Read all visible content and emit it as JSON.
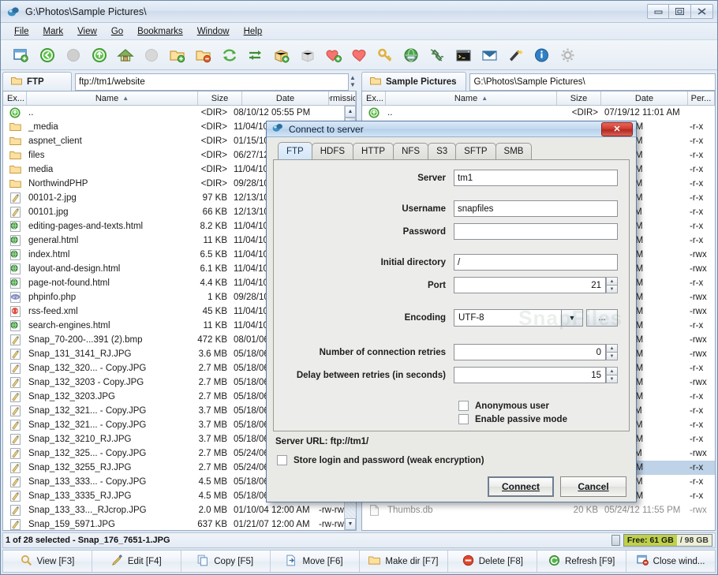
{
  "window": {
    "title": "G:\\Photos\\Sample Pictures\\",
    "icon": "app-icon",
    "minimize": "—",
    "maximize": "❐",
    "close": "✕"
  },
  "menu": [
    "File",
    "Mark",
    "View",
    "Go",
    "Bookmarks",
    "Window",
    "Help"
  ],
  "toolbar": [
    {
      "name": "new-tab-icon"
    },
    {
      "name": "back-icon"
    },
    {
      "name": "forward-icon"
    },
    {
      "name": "up-icon"
    },
    {
      "name": "home-icon"
    },
    {
      "name": "refresh-disabled-icon"
    },
    {
      "name": "new-folder-icon"
    },
    {
      "name": "delete-folder-icon"
    },
    {
      "name": "sync-icon"
    },
    {
      "name": "swap-panels-icon"
    },
    {
      "name": "pack-icon"
    },
    {
      "name": "unpack-icon"
    },
    {
      "name": "add-bookmark-icon"
    },
    {
      "name": "bookmarks-icon"
    },
    {
      "name": "key-icon"
    },
    {
      "name": "connect-server-icon"
    },
    {
      "name": "disconnect-icon"
    },
    {
      "name": "terminal-icon"
    },
    {
      "name": "email-icon"
    },
    {
      "name": "wand-icon"
    },
    {
      "name": "info-icon"
    },
    {
      "name": "settings-icon"
    }
  ],
  "left_panel": {
    "tab_label": "FTP",
    "path": "ftp://tm1/website",
    "columns": [
      "Ex...",
      "Name",
      "Size",
      "Date",
      "Permissio..."
    ],
    "sort_column": "Name",
    "sort_dir": "asc",
    "rows": [
      {
        "icon": "up-dir-icon",
        "name": "..",
        "size": "<DIR>",
        "date": "08/10/12 05:55 PM",
        "perm": ""
      },
      {
        "icon": "folder-icon",
        "name": "_media",
        "size": "<DIR>",
        "date": "11/04/10 12:0",
        "perm": ""
      },
      {
        "icon": "folder-icon",
        "name": "aspnet_client",
        "size": "<DIR>",
        "date": "01/15/10 12:0",
        "perm": ""
      },
      {
        "icon": "folder-icon",
        "name": "files",
        "size": "<DIR>",
        "date": "06/27/12 09:2",
        "perm": ""
      },
      {
        "icon": "folder-icon",
        "name": "media",
        "size": "<DIR>",
        "date": "11/04/10 12:0",
        "perm": ""
      },
      {
        "icon": "folder-icon",
        "name": "NorthwindPHP",
        "size": "<DIR>",
        "date": "09/28/10 12:0",
        "perm": ""
      },
      {
        "icon": "image-icon",
        "name": "00101-2.jpg",
        "size": "97 KB",
        "date": "12/13/10 12:0",
        "perm": ""
      },
      {
        "icon": "image-icon",
        "name": "00101.jpg",
        "size": "66 KB",
        "date": "12/13/10 12:0",
        "perm": ""
      },
      {
        "icon": "html-icon",
        "name": "editing-pages-and-texts.html",
        "size": "8.2 KB",
        "date": "11/04/10 12:0",
        "perm": ""
      },
      {
        "icon": "html-icon",
        "name": "general.html",
        "size": "11 KB",
        "date": "11/04/10 12:0",
        "perm": ""
      },
      {
        "icon": "html-icon",
        "name": "index.html",
        "size": "6.5 KB",
        "date": "11/04/10 12:0",
        "perm": ""
      },
      {
        "icon": "html-icon",
        "name": "layout-and-design.html",
        "size": "6.1 KB",
        "date": "11/04/10 12:0",
        "perm": ""
      },
      {
        "icon": "html-icon",
        "name": "page-not-found.html",
        "size": "4.4 KB",
        "date": "11/04/10 12:0",
        "perm": ""
      },
      {
        "icon": "php-icon",
        "name": "phpinfo.php",
        "size": "1 KB",
        "date": "09/28/10 12:0",
        "perm": ""
      },
      {
        "icon": "xml-icon",
        "name": "rss-feed.xml",
        "size": "45 KB",
        "date": "11/04/10 12:0",
        "perm": ""
      },
      {
        "icon": "html-icon",
        "name": "search-engines.html",
        "size": "11 KB",
        "date": "11/04/10 12:0",
        "perm": ""
      },
      {
        "icon": "image-icon",
        "name": "Snap_70-200-...391 (2).bmp",
        "size": "472 KB",
        "date": "08/01/06 12:0",
        "perm": ""
      },
      {
        "icon": "image-icon",
        "name": "Snap_131_3141_RJ.JPG",
        "size": "3.6 MB",
        "date": "05/18/06 12:0",
        "perm": ""
      },
      {
        "icon": "image-icon",
        "name": "Snap_132_320... - Copy.JPG",
        "size": "2.7 MB",
        "date": "05/18/06 12:0",
        "perm": ""
      },
      {
        "icon": "image-icon",
        "name": "Snap_132_3203 - Copy.JPG",
        "size": "2.7 MB",
        "date": "05/18/06 12:0",
        "perm": ""
      },
      {
        "icon": "image-icon",
        "name": "Snap_132_3203.JPG",
        "size": "2.7 MB",
        "date": "05/18/06 12:0",
        "perm": ""
      },
      {
        "icon": "image-icon",
        "name": "Snap_132_321... - Copy.JPG",
        "size": "3.7 MB",
        "date": "05/18/06 12:0",
        "perm": ""
      },
      {
        "icon": "image-icon",
        "name": "Snap_132_321... - Copy.JPG",
        "size": "3.7 MB",
        "date": "05/18/06 12:0",
        "perm": ""
      },
      {
        "icon": "image-icon",
        "name": "Snap_132_3210_RJ.JPG",
        "size": "3.7 MB",
        "date": "05/18/06 12:0",
        "perm": ""
      },
      {
        "icon": "image-icon",
        "name": "Snap_132_325... - Copy.JPG",
        "size": "2.7 MB",
        "date": "05/24/06 12:0",
        "perm": ""
      },
      {
        "icon": "image-icon",
        "name": "Snap_132_3255_RJ.JPG",
        "size": "2.7 MB",
        "date": "05/24/06 12:0",
        "perm": ""
      },
      {
        "icon": "image-icon",
        "name": "Snap_133_333... - Copy.JPG",
        "size": "4.5 MB",
        "date": "05/18/06 12:0",
        "perm": ""
      },
      {
        "icon": "image-icon",
        "name": "Snap_133_3335_RJ.JPG",
        "size": "4.5 MB",
        "date": "05/18/06 12:0",
        "perm": ""
      },
      {
        "icon": "image-icon",
        "name": "Snap_133_33..._RJcrop.JPG",
        "size": "2.0 MB",
        "date": "01/10/04 12:00 AM",
        "perm": "-rw-rw-rw-"
      },
      {
        "icon": "image-icon",
        "name": "Snap_159_5971.JPG",
        "size": "637 KB",
        "date": "01/21/07 12:00 AM",
        "perm": "-rw-rw-rw-"
      }
    ]
  },
  "right_panel": {
    "tab_label": "Sample Pictures",
    "path": "G:\\Photos\\Sample Pictures\\",
    "columns": [
      "Ex...",
      "Name",
      "Size",
      "Date",
      "Per..."
    ],
    "sort_column": "Name",
    "sort_dir": "asc",
    "rows": [
      {
        "icon": "up-dir-icon",
        "name": "..",
        "size": "<DIR>",
        "date": "07/19/12 11:01 AM",
        "perm": ""
      },
      {
        "icon": "",
        "name": "",
        "size": "",
        "date": "03:17 PM",
        "perm": "-r-x"
      },
      {
        "icon": "",
        "name": "",
        "size": "",
        "date": "12:32 AM",
        "perm": "-r-x"
      },
      {
        "icon": "",
        "name": "",
        "size": "",
        "date": "01:47 AM",
        "perm": "-r-x"
      },
      {
        "icon": "",
        "name": "",
        "size": "",
        "date": "12:03 AM",
        "perm": "-r-x"
      },
      {
        "icon": "",
        "name": "",
        "size": "",
        "date": "11:00 PM",
        "perm": "-r-x"
      },
      {
        "icon": "",
        "name": "",
        "size": "",
        "date": "09:57 AM",
        "perm": "-r-x"
      },
      {
        "icon": "",
        "name": "",
        "size": "",
        "date": "11:27 AM",
        "perm": "-r-x"
      },
      {
        "icon": "",
        "name": "",
        "size": "",
        "date": "12:44 AM",
        "perm": "-r-x"
      },
      {
        "icon": "",
        "name": "",
        "size": "",
        "date": "10:43 PM",
        "perm": "-r-x"
      },
      {
        "icon": "",
        "name": "",
        "size": "",
        "date": "10:42 PM",
        "perm": "-rwx"
      },
      {
        "icon": "",
        "name": "",
        "size": "",
        "date": "10:42 PM",
        "perm": "-rwx"
      },
      {
        "icon": "",
        "name": "",
        "size": "",
        "date": "10:42 PM",
        "perm": "-r-x"
      },
      {
        "icon": "",
        "name": "",
        "size": "",
        "date": "10:42 PM",
        "perm": "-rwx"
      },
      {
        "icon": "",
        "name": "",
        "size": "",
        "date": "10:42 PM",
        "perm": "-rwx"
      },
      {
        "icon": "",
        "name": "",
        "size": "",
        "date": "10:42 PM",
        "perm": "-r-x"
      },
      {
        "icon": "",
        "name": "",
        "size": "",
        "date": "02:18 PM",
        "perm": "-rwx"
      },
      {
        "icon": "",
        "name": "",
        "size": "",
        "date": "02:18 PM",
        "perm": "-rwx"
      },
      {
        "icon": "",
        "name": "",
        "size": "",
        "date": "02:18 PM",
        "perm": "-r-x"
      },
      {
        "icon": "",
        "name": "",
        "size": "",
        "date": "10:38 PM",
        "perm": "-rwx"
      },
      {
        "icon": "",
        "name": "",
        "size": "",
        "date": "10:38 PM",
        "perm": "-r-x"
      },
      {
        "icon": "",
        "name": "",
        "size": "",
        "date": "12:11 AM",
        "perm": "-r-x"
      },
      {
        "icon": "",
        "name": "",
        "size": "",
        "date": "08:56 AM",
        "perm": "-r-x"
      },
      {
        "icon": "",
        "name": "",
        "size": "",
        "date": "03:10 PM",
        "perm": "-r-x"
      },
      {
        "icon": "",
        "name": "",
        "size": "",
        "date": "11:01 AM",
        "perm": "-rwx"
      },
      {
        "icon": "",
        "name": "",
        "size": "",
        "date": "04:51 PM",
        "perm": "-r-x",
        "selected": true
      },
      {
        "icon": "",
        "name": "",
        "size": "",
        "date": "08:56 AM",
        "perm": "-r-x"
      },
      {
        "icon": "",
        "name": "",
        "size": "",
        "date": "03:13 PM",
        "perm": "-r-x"
      },
      {
        "icon": "file-icon",
        "name": "Thumbs.db",
        "size": "20 KB",
        "date": "05/24/12 11:55 PM",
        "perm": "-rwx",
        "grey": true
      }
    ]
  },
  "status": {
    "text": "1 of 28 selected - Snap_176_7651-1.JPG",
    "free_label": "Free: 61 GB",
    "total_label": "/ 98 GB"
  },
  "function_buttons": [
    {
      "icon": "magnifier-icon",
      "label": "View [F3]"
    },
    {
      "icon": "pencil-icon",
      "label": "Edit [F4]"
    },
    {
      "icon": "copy-icon",
      "label": "Copy [F5]"
    },
    {
      "icon": "move-icon",
      "label": "Move [F6]"
    },
    {
      "icon": "makedir-icon",
      "label": "Make dir [F7]"
    },
    {
      "icon": "delete-icon",
      "label": "Delete [F8]"
    },
    {
      "icon": "refresh-icon",
      "label": "Refresh [F9]"
    },
    {
      "icon": "closewindow-icon",
      "label": "Close wind..."
    }
  ],
  "dialog": {
    "title": "Connect to server",
    "close_label": "✕",
    "tabs": [
      "FTP",
      "HDFS",
      "HTTP",
      "NFS",
      "S3",
      "SFTP",
      "SMB"
    ],
    "active_tab": "FTP",
    "fields": [
      {
        "label": "Server",
        "value": "tm1",
        "type": "text"
      },
      {
        "label": "Username",
        "value": "snapfiles",
        "type": "text"
      },
      {
        "label": "Password",
        "value": "",
        "type": "password"
      },
      {
        "label": "Initial directory",
        "value": "/",
        "type": "text"
      },
      {
        "label": "Port",
        "value": "21",
        "type": "spinner"
      }
    ],
    "encoding_label": "Encoding",
    "encoding_value": "UTF-8",
    "encoding_more": "...",
    "retries_label": "Number of connection retries",
    "retries_value": "0",
    "delay_label": "Delay between retries (in seconds)",
    "delay_value": "15",
    "anonymous_label": "Anonymous user",
    "anonymous_checked": false,
    "passive_label": "Enable passive mode",
    "passive_checked": false,
    "server_url_label": "Server URL:",
    "server_url_value": "ftp://tm1/",
    "store_label": "Store login and password (weak encryption)",
    "store_checked": false,
    "connect_label": "Connect",
    "cancel_label": "Cancel",
    "watermark": "SnapFiles"
  }
}
